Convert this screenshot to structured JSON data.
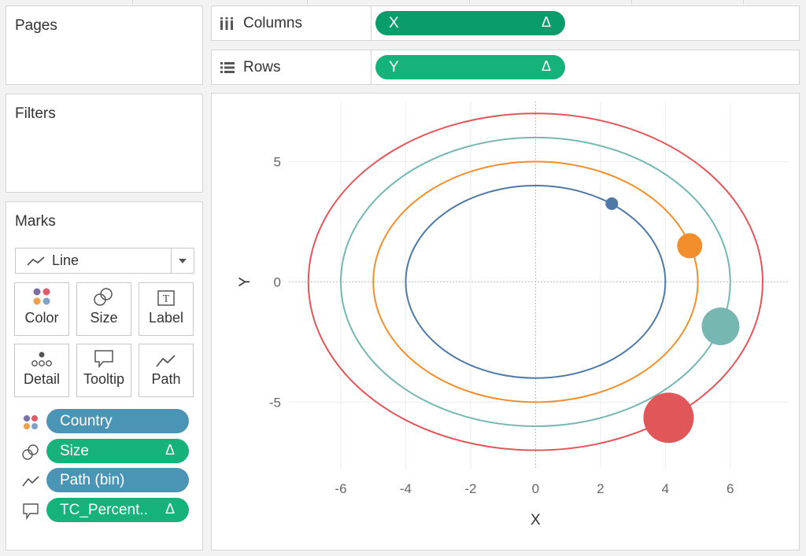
{
  "pages": {
    "title": "Pages"
  },
  "filters": {
    "title": "Filters"
  },
  "marks": {
    "title": "Marks",
    "mark_type": "Line",
    "cards": [
      {
        "label": "Color",
        "icon": "color-dots-icon"
      },
      {
        "label": "Size",
        "icon": "size-circles-icon"
      },
      {
        "label": "Label",
        "icon": "label-text-icon"
      },
      {
        "label": "Detail",
        "icon": "detail-dots-icon"
      },
      {
        "label": "Tooltip",
        "icon": "tooltip-speech-icon"
      },
      {
        "label": "Path",
        "icon": "path-line-icon"
      }
    ],
    "fields": [
      {
        "icon": "color-dots-icon",
        "label": "Country",
        "delta": "",
        "color": "#4a95b5"
      },
      {
        "icon": "size-circles-icon",
        "label": "Size",
        "delta": "Δ",
        "color": "#15b27b"
      },
      {
        "icon": "path-line-icon",
        "label": "Path (bin)",
        "delta": "",
        "color": "#4a95b5"
      },
      {
        "icon": "tooltip-speech-icon",
        "label": "TC_Percent..",
        "delta": "Δ",
        "color": "#15b27b"
      }
    ]
  },
  "shelves": {
    "columns": {
      "label": "Columns",
      "pill": "X",
      "delta": "Δ"
    },
    "rows": {
      "label": "Rows",
      "pill": "Y",
      "delta": "Δ"
    }
  },
  "chart_data": {
    "type": "scatter",
    "xlabel": "X",
    "ylabel": "Y",
    "xlim": [
      -7.6,
      7.8
    ],
    "ylim": [
      -7.8,
      7.5
    ],
    "x_ticks": [
      -6,
      -4,
      -2,
      0,
      2,
      4,
      6
    ],
    "y_ticks": [
      -5,
      0,
      5
    ],
    "grid": true,
    "series": [
      {
        "rx": 4,
        "ry": 4,
        "color": "#4e79a7",
        "point": [
          2.35,
          3.25
        ],
        "point_size": 8
      },
      {
        "rx": 5,
        "ry": 5,
        "color": "#f28e2b",
        "point": [
          4.75,
          1.5
        ],
        "point_size": 16
      },
      {
        "rx": 6,
        "ry": 6,
        "color": "#76b7b2",
        "point": [
          5.7,
          -1.85
        ],
        "point_size": 24
      },
      {
        "rx": 7,
        "ry": 7,
        "color": "#e15759",
        "point": [
          4.1,
          -5.65
        ],
        "point_size": 32
      }
    ]
  }
}
